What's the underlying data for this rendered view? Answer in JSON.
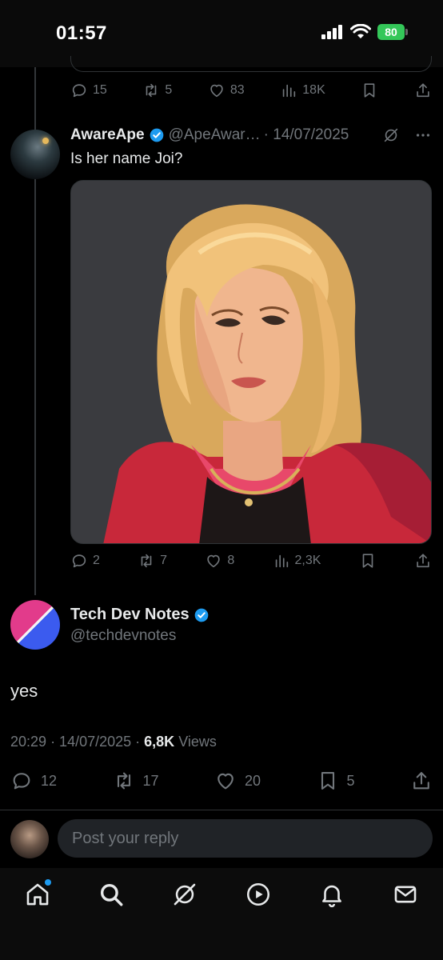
{
  "status_bar": {
    "time": "01:57",
    "battery": "80"
  },
  "prev_tweet": {
    "replies": "15",
    "reposts": "5",
    "likes": "83",
    "views": "18K"
  },
  "tweet2": {
    "name": "AwareApe",
    "handle": "@ApeAwar…",
    "date": "· 14/07/2025",
    "text": "Is her name Joi?",
    "replies": "2",
    "reposts": "7",
    "likes": "8",
    "views": "2,3K"
  },
  "main_tweet": {
    "name": "Tech Dev Notes",
    "handle": "@techdevnotes",
    "text": "yes",
    "time": "20:29",
    "date": "· 14/07/2025 ·",
    "views_count": "6,8K",
    "views_label": "Views",
    "replies": "12",
    "reposts": "17",
    "likes": "20",
    "bookmarks": "5"
  },
  "reply_box": {
    "placeholder": "Post your reply"
  },
  "nav": {
    "items": [
      "home-icon",
      "search-icon",
      "grok-icon",
      "video-icon",
      "notifications-icon",
      "messages-icon"
    ]
  },
  "colors": {
    "accent": "#1d9bf0",
    "muted": "#71767b",
    "text": "#e7e9ea",
    "battery": "#34c759"
  }
}
